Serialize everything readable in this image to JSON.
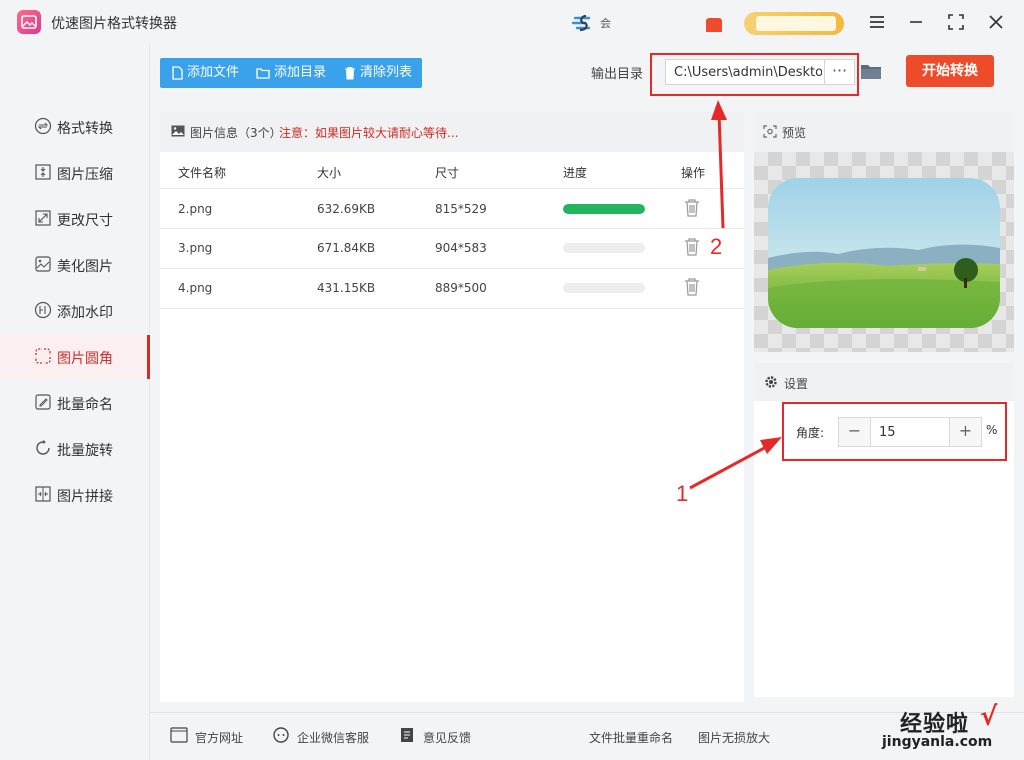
{
  "app": {
    "title": "优速图片格式转换器",
    "brand_text": "会"
  },
  "colors": {
    "accent_blue": "#3aa2ea",
    "start_red": "#ee4b2b",
    "active_red": "#c9302c",
    "progress_green": "#22b45e",
    "annotation_red": "#e52929"
  },
  "sidebar": {
    "items": [
      {
        "label": "格式转换",
        "icon": "format-convert-icon"
      },
      {
        "label": "图片压缩",
        "icon": "compress-icon"
      },
      {
        "label": "更改尺寸",
        "icon": "resize-icon"
      },
      {
        "label": "美化图片",
        "icon": "beautify-icon"
      },
      {
        "label": "添加水印",
        "icon": "watermark-icon"
      },
      {
        "label": "图片圆角",
        "icon": "round-corner-icon",
        "active": true
      },
      {
        "label": "批量命名",
        "icon": "rename-icon"
      },
      {
        "label": "批量旋转",
        "icon": "rotate-icon"
      },
      {
        "label": "图片拼接",
        "icon": "stitch-icon"
      }
    ]
  },
  "toolbar": {
    "add_file": "添加文件",
    "add_folder": "添加目录",
    "clear_list": "清除列表",
    "output_label": "输出目录",
    "output_path": "C:\\Users\\admin\\Desktop",
    "browse": "···",
    "start": "开始转换"
  },
  "file_list": {
    "title": "图片信息（3个）",
    "notice": "注意：如果图片较大请耐心等待...",
    "columns": [
      "文件名称",
      "大小",
      "尺寸",
      "进度",
      "操作"
    ],
    "rows": [
      {
        "name": "2.png",
        "size": "632.69KB",
        "dims": "815*529",
        "progress": 1.0
      },
      {
        "name": "3.png",
        "size": "671.84KB",
        "dims": "904*583",
        "progress": 0.0
      },
      {
        "name": "4.png",
        "size": "431.15KB",
        "dims": "889*500",
        "progress": 0.0
      }
    ]
  },
  "preview": {
    "title": "预览"
  },
  "settings": {
    "title": "设置",
    "angle_label": "角度:",
    "minus": "−",
    "plus": "+",
    "angle_value": "15",
    "unit": "%"
  },
  "annotations": {
    "one": "1",
    "two": "2"
  },
  "footer": {
    "website": "官方网址",
    "wechat": "企业微信客服",
    "feedback": "意见反馈",
    "batch_rename": "文件批量重命名",
    "lossless": "图片无损放大"
  },
  "watermark": {
    "main": "经验啦",
    "sub": "jingyanla.com",
    "check": "√"
  }
}
